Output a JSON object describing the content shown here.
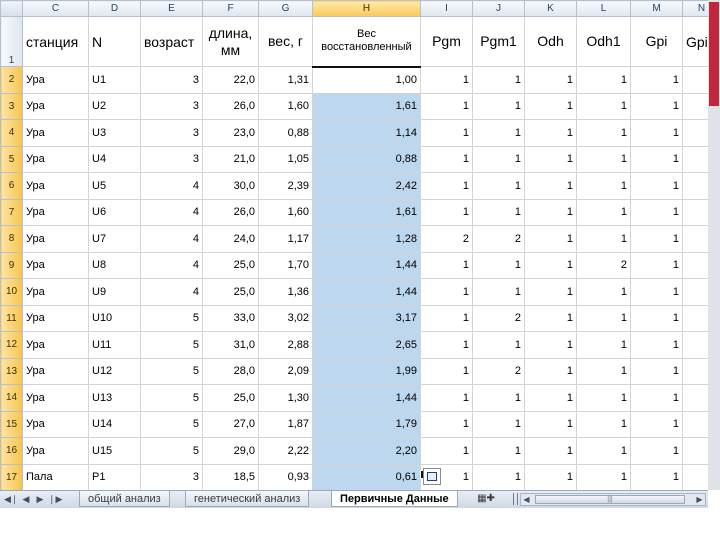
{
  "columns": [
    "C",
    "D",
    "E",
    "F",
    "G",
    "H",
    "I",
    "J",
    "K",
    "L",
    "M",
    "N"
  ],
  "selected_column": "H",
  "header_row": {
    "row_number": "1",
    "cells": [
      "станция",
      "N",
      "возраст",
      "длина, мм",
      "вес, г",
      "Вес восстановленный",
      "Pgm",
      "Pgm1",
      "Odh",
      "Odh1",
      "Gpi",
      "Gpi"
    ]
  },
  "rows": [
    {
      "n": "2",
      "station": "Ура",
      "id": "U1",
      "age": "3",
      "length": "22,0",
      "weight": "1,31",
      "restored": "1,00",
      "pgm": "1",
      "pgm1": "1",
      "odh": "1",
      "odh1": "1",
      "gpi": "1"
    },
    {
      "n": "3",
      "station": "Ура",
      "id": "U2",
      "age": "3",
      "length": "26,0",
      "weight": "1,60",
      "restored": "1,61",
      "pgm": "1",
      "pgm1": "1",
      "odh": "1",
      "odh1": "1",
      "gpi": "1"
    },
    {
      "n": "4",
      "station": "Ура",
      "id": "U3",
      "age": "3",
      "length": "23,0",
      "weight": "0,88",
      "restored": "1,14",
      "pgm": "1",
      "pgm1": "1",
      "odh": "1",
      "odh1": "1",
      "gpi": "1"
    },
    {
      "n": "5",
      "station": "Ура",
      "id": "U4",
      "age": "3",
      "length": "21,0",
      "weight": "1,05",
      "restored": "0,88",
      "pgm": "1",
      "pgm1": "1",
      "odh": "1",
      "odh1": "1",
      "gpi": "1"
    },
    {
      "n": "6",
      "station": "Ура",
      "id": "U5",
      "age": "4",
      "length": "30,0",
      "weight": "2,39",
      "restored": "2,42",
      "pgm": "1",
      "pgm1": "1",
      "odh": "1",
      "odh1": "1",
      "gpi": "1"
    },
    {
      "n": "7",
      "station": "Ура",
      "id": "U6",
      "age": "4",
      "length": "26,0",
      "weight": "1,60",
      "restored": "1,61",
      "pgm": "1",
      "pgm1": "1",
      "odh": "1",
      "odh1": "1",
      "gpi": "1"
    },
    {
      "n": "8",
      "station": "Ура",
      "id": "U7",
      "age": "4",
      "length": "24,0",
      "weight": "1,17",
      "restored": "1,28",
      "pgm": "2",
      "pgm1": "2",
      "odh": "1",
      "odh1": "1",
      "gpi": "1"
    },
    {
      "n": "9",
      "station": "Ура",
      "id": "U8",
      "age": "4",
      "length": "25,0",
      "weight": "1,70",
      "restored": "1,44",
      "pgm": "1",
      "pgm1": "1",
      "odh": "1",
      "odh1": "2",
      "gpi": "1"
    },
    {
      "n": "10",
      "station": "Ура",
      "id": "U9",
      "age": "4",
      "length": "25,0",
      "weight": "1,36",
      "restored": "1,44",
      "pgm": "1",
      "pgm1": "1",
      "odh": "1",
      "odh1": "1",
      "gpi": "1"
    },
    {
      "n": "11",
      "station": "Ура",
      "id": "U10",
      "age": "5",
      "length": "33,0",
      "weight": "3,02",
      "restored": "3,17",
      "pgm": "1",
      "pgm1": "2",
      "odh": "1",
      "odh1": "1",
      "gpi": "1"
    },
    {
      "n": "12",
      "station": "Ура",
      "id": "U11",
      "age": "5",
      "length": "31,0",
      "weight": "2,88",
      "restored": "2,65",
      "pgm": "1",
      "pgm1": "1",
      "odh": "1",
      "odh1": "1",
      "gpi": "1"
    },
    {
      "n": "13",
      "station": "Ура",
      "id": "U12",
      "age": "5",
      "length": "28,0",
      "weight": "2,09",
      "restored": "1,99",
      "pgm": "1",
      "pgm1": "2",
      "odh": "1",
      "odh1": "1",
      "gpi": "1"
    },
    {
      "n": "14",
      "station": "Ура",
      "id": "U13",
      "age": "5",
      "length": "25,0",
      "weight": "1,30",
      "restored": "1,44",
      "pgm": "1",
      "pgm1": "1",
      "odh": "1",
      "odh1": "1",
      "gpi": "1"
    },
    {
      "n": "15",
      "station": "Ура",
      "id": "U14",
      "age": "5",
      "length": "27,0",
      "weight": "1,87",
      "restored": "1,79",
      "pgm": "1",
      "pgm1": "1",
      "odh": "1",
      "odh1": "1",
      "gpi": "1"
    },
    {
      "n": "16",
      "station": "Ура",
      "id": "U15",
      "age": "5",
      "length": "29,0",
      "weight": "2,22",
      "restored": "2,20",
      "pgm": "1",
      "pgm1": "1",
      "odh": "1",
      "odh1": "1",
      "gpi": "1"
    },
    {
      "n": "17",
      "station": "Пала",
      "id": "P1",
      "age": "3",
      "length": "18,5",
      "weight": "0,93",
      "restored": "0,61",
      "pgm": "1",
      "pgm1": "1",
      "odh": "1",
      "odh1": "1",
      "gpi": "1"
    }
  ],
  "sheet_tabs": [
    {
      "label": "общий анализ",
      "active": false
    },
    {
      "label": "генетический анализ",
      "active": false
    },
    {
      "label": "Первичные Данные",
      "active": true
    }
  ],
  "nav_icons": [
    "first-sheet-icon",
    "prev-sheet-icon",
    "next-sheet-icon",
    "last-sheet-icon"
  ],
  "colors": {
    "selection_fill": "#bdd7ee",
    "header_highlight": "#f9c95a",
    "scroll_accent": "#c2263a"
  }
}
